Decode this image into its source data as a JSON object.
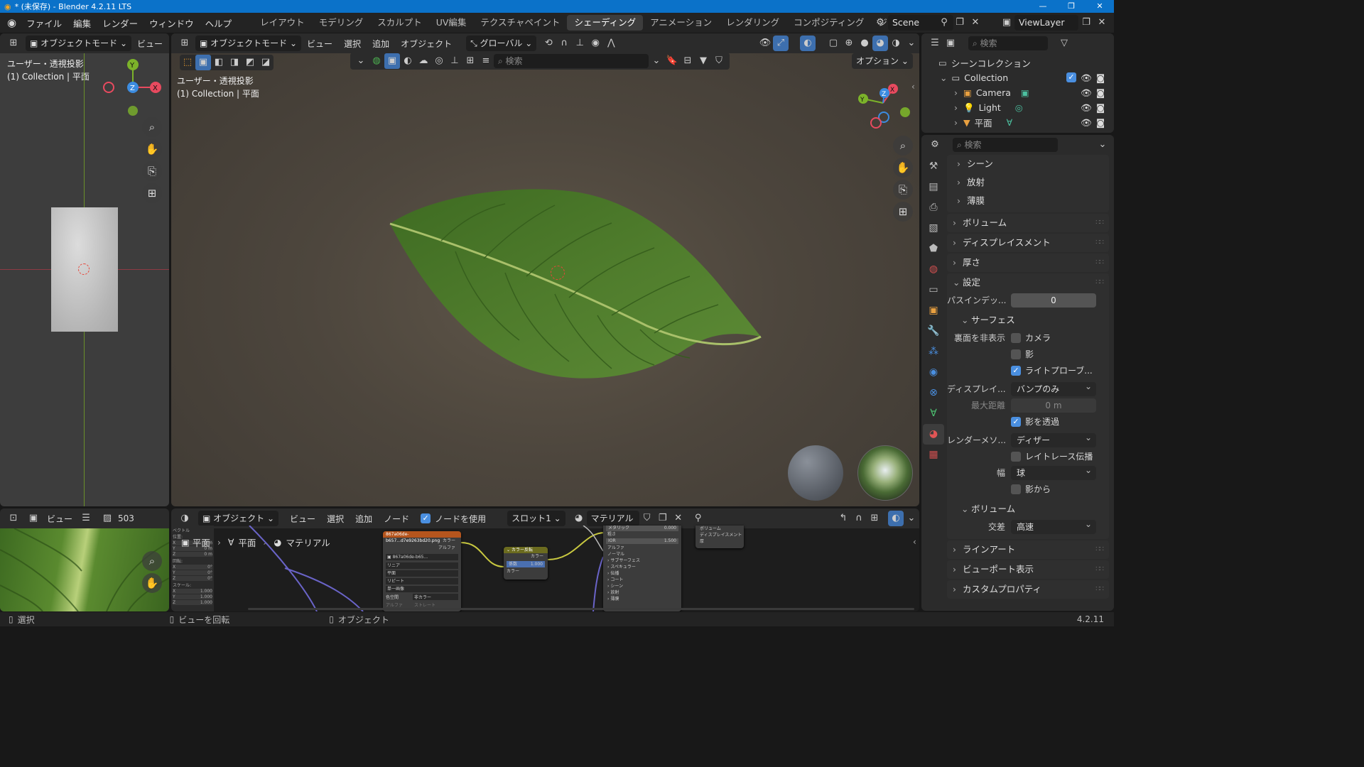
{
  "window": {
    "title": "* (未保存) - Blender 4.2.11 LTS"
  },
  "menu": [
    "ファイル",
    "編集",
    "レンダー",
    "ウィンドウ",
    "ヘルプ"
  ],
  "workspaces": [
    "レイアウト",
    "モデリング",
    "スカルプト",
    "UV編集",
    "テクスチャペイント",
    "シェーディング",
    "アニメーション",
    "レンダリング",
    "コンポジティング",
    "ジオメトリ"
  ],
  "active_workspace": "シェーディング",
  "scene": "Scene",
  "view_layer": "ViewLayer",
  "left_viewport": {
    "mode": "オブジェクトモード",
    "view_menu": "ビュー",
    "overlay_line1": "ユーザー・透視投影",
    "overlay_line2": "(1) Collection | 平面"
  },
  "main_viewport": {
    "mode": "オブジェクトモード",
    "menus": [
      "ビュー",
      "選択",
      "追加",
      "オブジェクト"
    ],
    "transform": "グローバル",
    "search_placeholder": "検索",
    "options": "オプション",
    "overlay_line1": "ユーザー・透視投影",
    "overlay_line2": "(1) Collection | 平面"
  },
  "outliner": {
    "search_placeholder": "検索",
    "root": "シーンコレクション",
    "collection": "Collection",
    "items": [
      "Camera",
      "Light",
      "平面"
    ]
  },
  "properties": {
    "search_placeholder": "検索",
    "sub_panels": [
      "シーン",
      "放射",
      "薄膜"
    ],
    "panels_top": [
      "ボリューム",
      "ディスプレイスメント",
      "厚さ"
    ],
    "settings": "設定",
    "pass_index_label": "パスインデッ...",
    "pass_index_value": "0",
    "surface": "サーフェス",
    "backface_label": "裏面を非表示",
    "camera": "カメラ",
    "shadow": "影",
    "light_probe": "ライトプローブ...",
    "display_label": "ディスプレイ...",
    "display_value": "バンプのみ",
    "max_distance_label": "最大距離",
    "max_distance_value": "0 m",
    "transparent_shadow": "影を透過",
    "render_method_label": "レンダーメソ...",
    "render_method_value": "ディザー",
    "raytrace": "レイトレース伝播",
    "width_label": "幅",
    "width_value": "球",
    "from_shadow": "影から",
    "volume": "ボリューム",
    "intersection_label": "交差",
    "intersection_value": "高速",
    "panels_bottom": [
      "ラインアート",
      "ビューポート表示",
      "カスタムプロパティ"
    ]
  },
  "image_editor": {
    "view": "ビュー",
    "frame": "503"
  },
  "node_editor": {
    "type": "オブジェクト",
    "menus": [
      "ビュー",
      "選択",
      "追加",
      "ノード"
    ],
    "use_nodes": "ノードを使用",
    "slot": "スロット1",
    "material": "マテリアル",
    "breadcrumb": [
      "平面",
      "平面",
      "マテリアル"
    ],
    "image_node_title": "867a06de-b657...d7e9263bd20.png",
    "image_node_file": "867a06de-b65...",
    "image_node_out_color": "カラー",
    "image_node_out_alpha": "アルファ",
    "image_node_opts": [
      "リニア",
      "平面",
      "リピート",
      "単一画像"
    ],
    "image_node_colorspace_label": "色空間",
    "image_node_colorspace_value": "非カラー",
    "image_node_alpha_label": "アルファ",
    "image_node_alpha_value": "ストレート",
    "invert_node_title": "カラー反転",
    "invert_node_out": "カラー",
    "invert_factor_label": "係数",
    "invert_factor_value": "1.000",
    "invert_in": "カラー",
    "bsdf_rows": [
      "メタリック",
      "粗さ",
      "IOR",
      "アルファ",
      "ノーマル",
      "サブサーフェス",
      "スペキュラー",
      "伝播",
      "コート",
      "シーン",
      "放射",
      "薄膜"
    ],
    "bsdf_metallic": "0.000",
    "bsdf_ior": "1.500",
    "output_rows": [
      "ボリューム",
      "ディスプレイスメント",
      "厚"
    ],
    "side_panel": [
      "ベクトル",
      "位置:",
      "X",
      "Y",
      "Z",
      "回転:",
      "X",
      "Y",
      "Z",
      "スケール:",
      "X",
      "Y",
      "Z"
    ],
    "side_values": [
      "0 m",
      "0 m",
      "0 m",
      "0°",
      "0°",
      "0°",
      "1.000",
      "1.000",
      "1.000"
    ]
  },
  "status": {
    "select": "選択",
    "rotate": "ビューを回転",
    "object": "オブジェクト",
    "version": "4.2.11"
  },
  "colors": {
    "accent": "#4a8fe0",
    "title_bar": "#0b72c9",
    "x_axis": "#e84a5f",
    "y_axis": "#7cb32a",
    "z_axis": "#3c8ce0",
    "leaf": "#4f7c2c"
  }
}
